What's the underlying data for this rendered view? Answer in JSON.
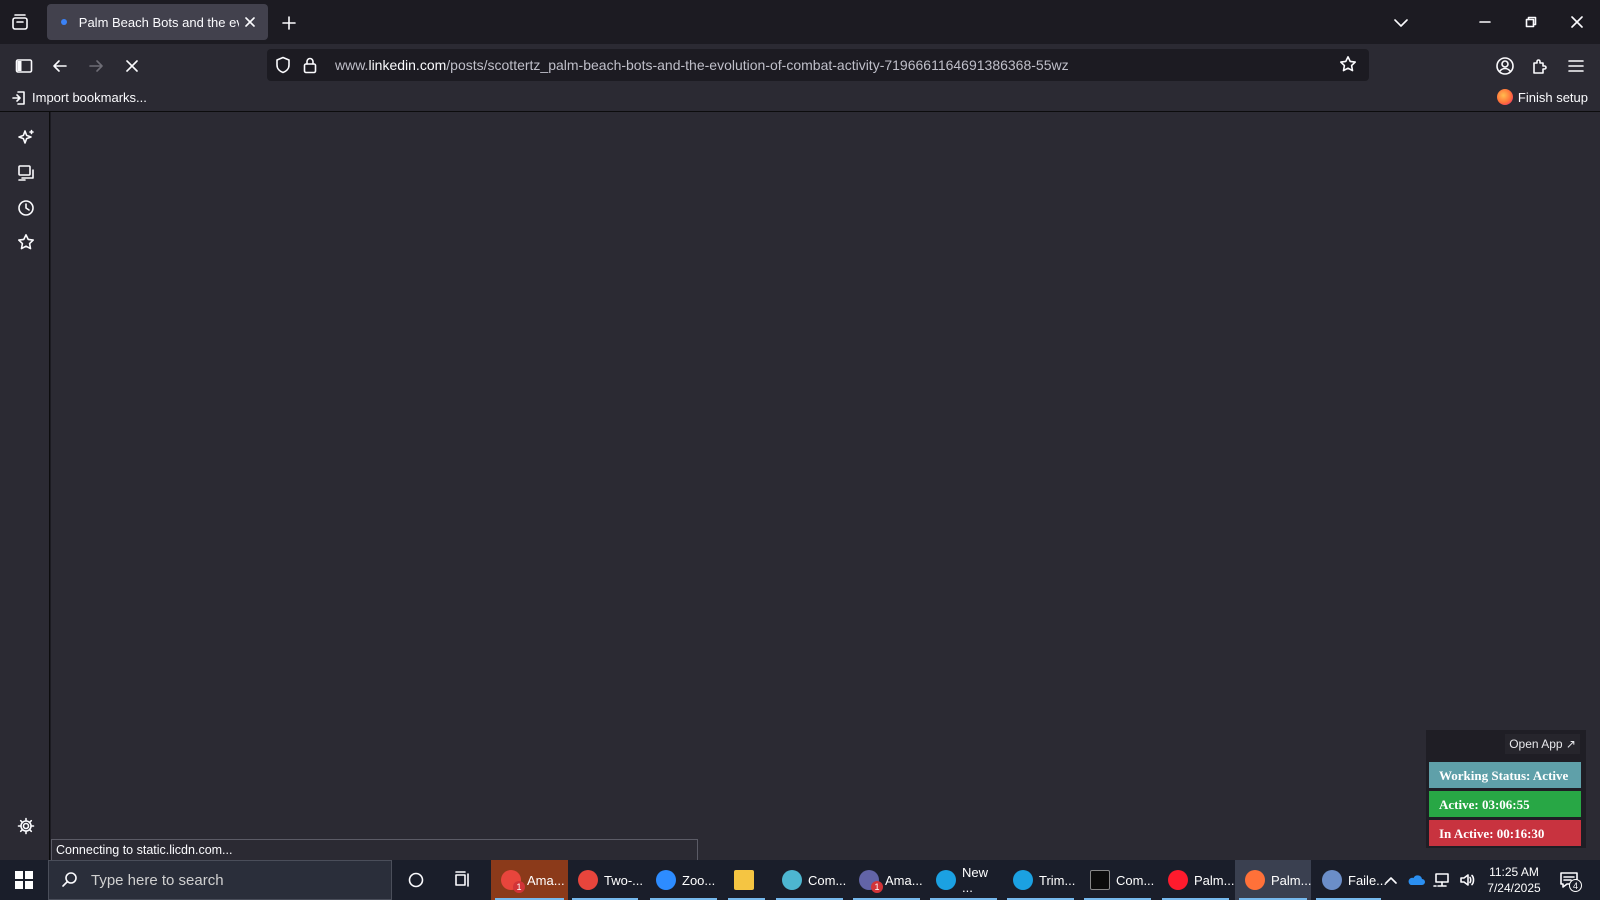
{
  "browser": {
    "tab": {
      "title": "Palm Beach Bots and the evoluti"
    },
    "url": {
      "prefix": "www.",
      "domain": "linkedin.com",
      "path": "/posts/scottertz_palm-beach-bots-and-the-evolution-of-combat-activity-7196661164691386368-55wz"
    },
    "bookmarks": {
      "import_label": "Import bookmarks...",
      "finish_setup_label": "Finish setup"
    },
    "status_text": "Connecting to static.licdn.com..."
  },
  "tracker": {
    "open_app_label": "Open App ↗",
    "working_status": "Working Status: Active",
    "active_time": "Active: 03:06:55",
    "inactive_time": "In Active: 00:16:30"
  },
  "taskbar": {
    "search_placeholder": "Type here to search",
    "apps": [
      {
        "label": "Ama...",
        "icon": "chrome-icon",
        "color": "#e8453c"
      },
      {
        "label": "Two-...",
        "icon": "chrome-icon",
        "color": "#e8453c"
      },
      {
        "label": "Zoo...",
        "icon": "zoom-icon",
        "color": "#2d8cff"
      },
      {
        "label": "",
        "icon": "file-explorer-icon",
        "color": "#f5c542"
      },
      {
        "label": "Com...",
        "icon": "app-icon",
        "color": "#4db6d0"
      },
      {
        "label": "Ama...",
        "icon": "teams-icon",
        "color": "#6264a7"
      },
      {
        "label": "New ...",
        "icon": "edge-icon",
        "color": "#1ba1e2"
      },
      {
        "label": "Trim...",
        "icon": "edge-icon",
        "color": "#1ba1e2"
      },
      {
        "label": "Com...",
        "icon": "terminal-icon",
        "color": "#0c0c0c"
      },
      {
        "label": "Palm...",
        "icon": "opera-icon",
        "color": "#ff1b2d"
      },
      {
        "label": "Palm...",
        "icon": "firefox-icon",
        "color": "#ff7139"
      },
      {
        "label": "Faile...",
        "icon": "globe-icon",
        "color": "#6b8ec8"
      }
    ],
    "badges": {
      "chrome": "1",
      "teams": "1"
    },
    "clock": {
      "time": "11:25 AM",
      "date": "7/24/2025"
    },
    "notification_count": "4"
  }
}
